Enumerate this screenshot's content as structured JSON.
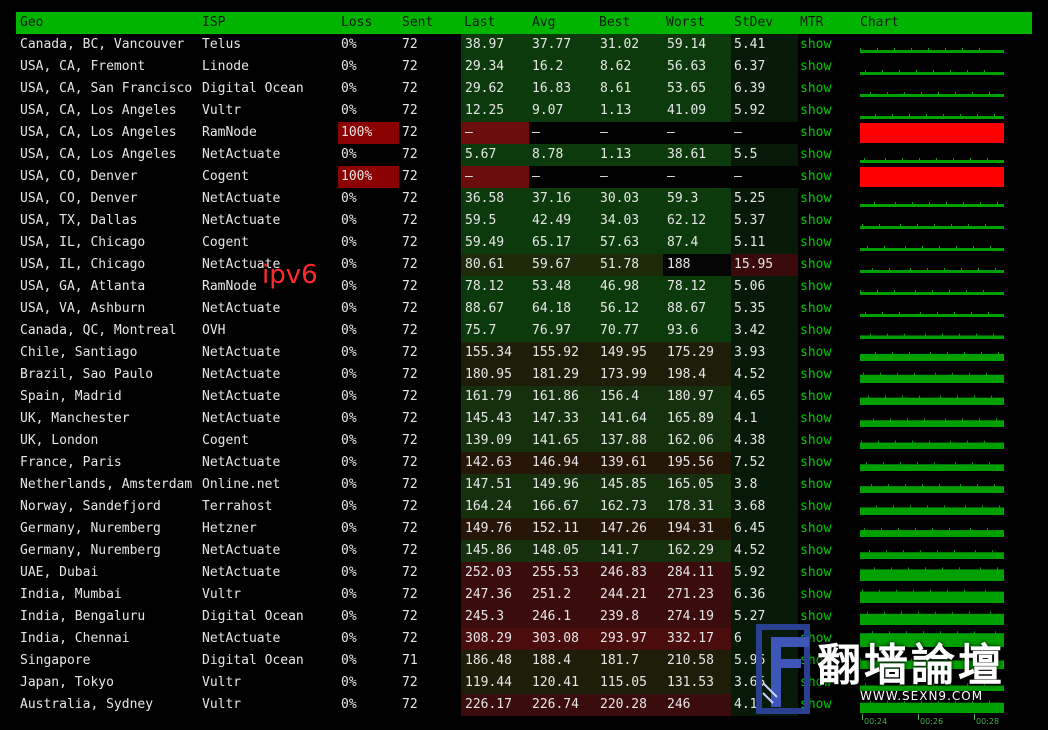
{
  "columns": {
    "geo": "Geo",
    "isp": "ISP",
    "loss": "Loss",
    "sent": "Sent",
    "last": "Last",
    "avg": "Avg",
    "best": "Best",
    "worst": "Worst",
    "stdev": "StDev",
    "mtr": "MTR",
    "chart": "Chart"
  },
  "colors": {
    "header_bg": "#00b400",
    "ok_green": "#0b3d0b",
    "mid_green": "#123d12",
    "slow_red": "#3a0c0c",
    "loss_red": "#8b0000",
    "chart_green": "#00a000",
    "chart_loss": "#ff0000",
    "link_green": "#00cc00",
    "annotation_red": "#ff2a2a"
  },
  "rows": [
    {
      "geo": "Canada, BC, Vancouver",
      "isp": "Telus",
      "loss": "0%",
      "sent": "72",
      "last": "38.97",
      "avg": "37.77",
      "best": "31.02",
      "worst": "59.14",
      "stdev": "5.41",
      "mtr": "show",
      "level": 1
    },
    {
      "geo": "USA, CA, Fremont",
      "isp": "Linode",
      "loss": "0%",
      "sent": "72",
      "last": "29.34",
      "avg": "16.2",
      "best": "8.62",
      "worst": "56.63",
      "stdev": "6.37",
      "mtr": "show",
      "level": 1
    },
    {
      "geo": "USA, CA, San Francisco",
      "isp": "Digital Ocean",
      "loss": "0%",
      "sent": "72",
      "last": "29.62",
      "avg": "16.83",
      "best": "8.61",
      "worst": "53.65",
      "stdev": "6.39",
      "mtr": "show",
      "level": 1
    },
    {
      "geo": "USA, CA, Los Angeles",
      "isp": "Vultr",
      "loss": "0%",
      "sent": "72",
      "last": "12.25",
      "avg": "9.07",
      "best": "1.13",
      "worst": "41.09",
      "stdev": "5.92",
      "mtr": "show",
      "level": 1
    },
    {
      "geo": "USA, CA, Los Angeles",
      "isp": "RamNode",
      "loss": "100%",
      "sent": "72",
      "last": "–",
      "avg": "–",
      "best": "–",
      "worst": "–",
      "stdev": "–",
      "mtr": "show",
      "level": 9
    },
    {
      "geo": "USA, CA, Los Angeles",
      "isp": "NetActuate",
      "loss": "0%",
      "sent": "72",
      "last": "5.67",
      "avg": "8.78",
      "best": "1.13",
      "worst": "38.61",
      "stdev": "5.5",
      "mtr": "show",
      "level": 1
    },
    {
      "geo": "USA, CO, Denver",
      "isp": "Cogent",
      "loss": "100%",
      "sent": "72",
      "last": "–",
      "avg": "–",
      "best": "–",
      "worst": "–",
      "stdev": "–",
      "mtr": "show",
      "level": 9
    },
    {
      "geo": "USA, CO, Denver",
      "isp": "NetActuate",
      "loss": "0%",
      "sent": "72",
      "last": "36.58",
      "avg": "37.16",
      "best": "30.03",
      "worst": "59.3",
      "stdev": "5.25",
      "mtr": "show",
      "level": 1
    },
    {
      "geo": "USA, TX, Dallas",
      "isp": "NetActuate",
      "loss": "0%",
      "sent": "72",
      "last": "59.5",
      "avg": "42.49",
      "best": "34.03",
      "worst": "62.12",
      "stdev": "5.37",
      "mtr": "show",
      "level": 1
    },
    {
      "geo": "USA, IL, Chicago",
      "isp": "Cogent",
      "loss": "0%",
      "sent": "72",
      "last": "59.49",
      "avg": "65.17",
      "best": "57.63",
      "worst": "87.4",
      "stdev": "5.11",
      "mtr": "show",
      "level": 1
    },
    {
      "geo": "USA, IL, Chicago",
      "isp": "NetActuate",
      "loss": "0%",
      "sent": "72",
      "last": "80.61",
      "avg": "59.67",
      "best": "51.78",
      "worst": "188",
      "stdev": "15.95",
      "mtr": "show",
      "level": 2
    },
    {
      "geo": "USA, GA, Atlanta",
      "isp": "RamNode",
      "loss": "0%",
      "sent": "72",
      "last": "78.12",
      "avg": "53.48",
      "best": "46.98",
      "worst": "78.12",
      "stdev": "5.06",
      "mtr": "show",
      "level": 1
    },
    {
      "geo": "USA, VA, Ashburn",
      "isp": "NetActuate",
      "loss": "0%",
      "sent": "72",
      "last": "88.67",
      "avg": "64.18",
      "best": "56.12",
      "worst": "88.67",
      "stdev": "5.35",
      "mtr": "show",
      "level": 1
    },
    {
      "geo": "Canada, QC, Montreal",
      "isp": "OVH",
      "loss": "0%",
      "sent": "72",
      "last": "75.7",
      "avg": "76.97",
      "best": "70.77",
      "worst": "93.6",
      "stdev": "3.42",
      "mtr": "show",
      "level": 1
    },
    {
      "geo": "Chile, Santiago",
      "isp": "NetActuate",
      "loss": "0%",
      "sent": "72",
      "last": "155.34",
      "avg": "155.92",
      "best": "149.95",
      "worst": "175.29",
      "stdev": "3.93",
      "mtr": "show",
      "level": 3
    },
    {
      "geo": "Brazil, Sao Paulo",
      "isp": "NetActuate",
      "loss": "0%",
      "sent": "72",
      "last": "180.95",
      "avg": "181.29",
      "best": "173.99",
      "worst": "198.4",
      "stdev": "4.52",
      "mtr": "show",
      "level": 3
    },
    {
      "geo": "Spain, Madrid",
      "isp": "NetActuate",
      "loss": "0%",
      "sent": "72",
      "last": "161.79",
      "avg": "161.86",
      "best": "156.4",
      "worst": "180.97",
      "stdev": "4.65",
      "mtr": "show",
      "level": 4
    },
    {
      "geo": "UK, Manchester",
      "isp": "NetActuate",
      "loss": "0%",
      "sent": "72",
      "last": "145.43",
      "avg": "147.33",
      "best": "141.64",
      "worst": "165.89",
      "stdev": "4.1",
      "mtr": "show",
      "level": 4
    },
    {
      "geo": "UK, London",
      "isp": "Cogent",
      "loss": "0%",
      "sent": "72",
      "last": "139.09",
      "avg": "141.65",
      "best": "137.88",
      "worst": "162.06",
      "stdev": "4.38",
      "mtr": "show",
      "level": 4
    },
    {
      "geo": "France, Paris",
      "isp": "NetActuate",
      "loss": "0%",
      "sent": "72",
      "last": "142.63",
      "avg": "146.94",
      "best": "139.61",
      "worst": "195.56",
      "stdev": "7.52",
      "mtr": "show",
      "level": 5
    },
    {
      "geo": "Netherlands, Amsterdam",
      "isp": "Online.net",
      "loss": "0%",
      "sent": "72",
      "last": "147.51",
      "avg": "149.96",
      "best": "145.85",
      "worst": "165.05",
      "stdev": "3.8",
      "mtr": "show",
      "level": 4
    },
    {
      "geo": "Norway, Sandefjord",
      "isp": "Terrahost",
      "loss": "0%",
      "sent": "72",
      "last": "164.24",
      "avg": "166.67",
      "best": "162.73",
      "worst": "178.31",
      "stdev": "3.68",
      "mtr": "show",
      "level": 4
    },
    {
      "geo": "Germany, Nuremberg",
      "isp": "Hetzner",
      "loss": "0%",
      "sent": "72",
      "last": "149.76",
      "avg": "152.11",
      "best": "147.26",
      "worst": "194.31",
      "stdev": "6.45",
      "mtr": "show",
      "level": 5
    },
    {
      "geo": "Germany, Nuremberg",
      "isp": "NetActuate",
      "loss": "0%",
      "sent": "72",
      "last": "145.86",
      "avg": "148.05",
      "best": "141.7",
      "worst": "162.29",
      "stdev": "4.52",
      "mtr": "show",
      "level": 4
    },
    {
      "geo": "UAE, Dubai",
      "isp": "NetActuate",
      "loss": "0%",
      "sent": "72",
      "last": "252.03",
      "avg": "255.53",
      "best": "246.83",
      "worst": "284.11",
      "stdev": "5.92",
      "mtr": "show",
      "level": 6
    },
    {
      "geo": "India, Mumbai",
      "isp": "Vultr",
      "loss": "0%",
      "sent": "72",
      "last": "247.36",
      "avg": "251.2",
      "best": "244.21",
      "worst": "271.23",
      "stdev": "6.36",
      "mtr": "show",
      "level": 6
    },
    {
      "geo": "India, Bengaluru",
      "isp": "Digital Ocean",
      "loss": "0%",
      "sent": "72",
      "last": "245.3",
      "avg": "246.1",
      "best": "239.8",
      "worst": "274.19",
      "stdev": "5.27",
      "mtr": "show",
      "level": 6
    },
    {
      "geo": "India, Chennai",
      "isp": "NetActuate",
      "loss": "0%",
      "sent": "72",
      "last": "308.29",
      "avg": "303.08",
      "best": "293.97",
      "worst": "332.17",
      "stdev": "6",
      "mtr": "show",
      "level": 7
    },
    {
      "geo": "Singapore",
      "isp": "Digital Ocean",
      "loss": "0%",
      "sent": "71",
      "last": "186.48",
      "avg": "188.4",
      "best": "181.7",
      "worst": "210.58",
      "stdev": "5.96",
      "mtr": "show",
      "level": 3
    },
    {
      "geo": "Japan, Tokyo",
      "isp": "Vultr",
      "loss": "0%",
      "sent": "72",
      "last": "119.44",
      "avg": "120.41",
      "best": "115.05",
      "worst": "131.53",
      "stdev": "3.65",
      "mtr": "show",
      "level": 3
    },
    {
      "geo": "Australia, Sydney",
      "isp": "Vultr",
      "loss": "0%",
      "sent": "72",
      "last": "226.17",
      "avg": "226.74",
      "best": "220.28",
      "worst": "246",
      "stdev": "4.1",
      "mtr": "show",
      "level": 6
    }
  ],
  "annotation": "ipv6",
  "time_axis": [
    "00:24",
    "00:26",
    "00:28"
  ],
  "watermark": {
    "title": "翻墙論壇",
    "url": "WWW.SEXN9.COM"
  }
}
